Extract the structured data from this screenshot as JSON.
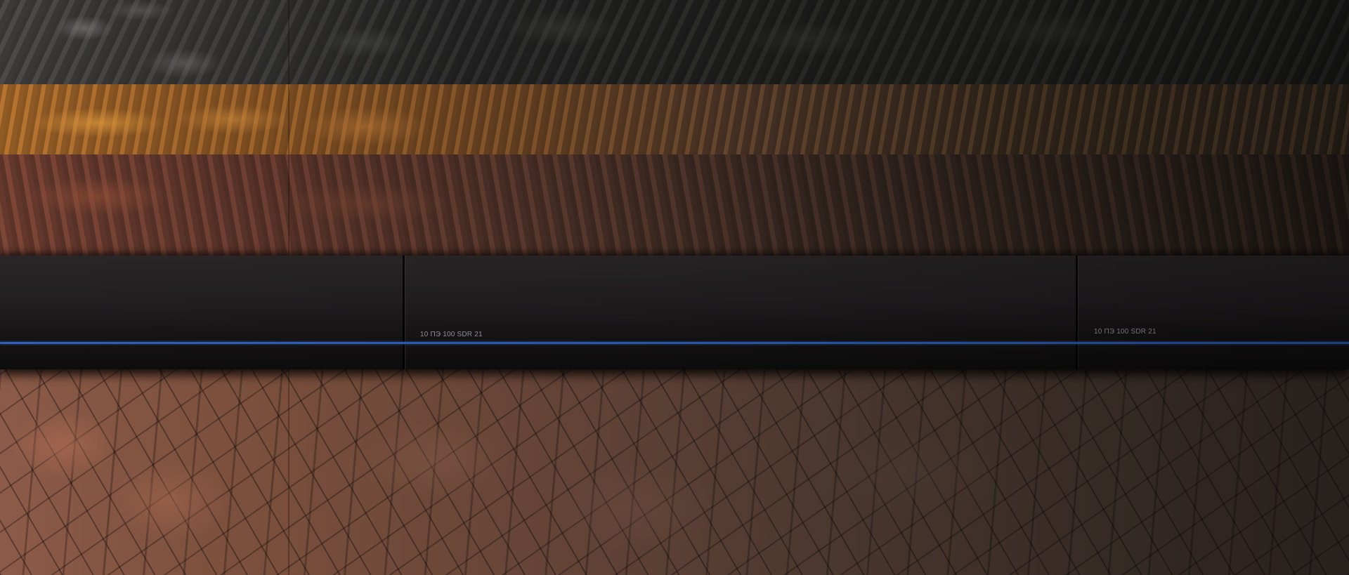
{
  "scene": {
    "pipe_markings": [
      "10 ПЭ 100 SDR 21",
      "10 ПЭ 100 SDR 21"
    ],
    "colors": {
      "pipe": "#1c191b",
      "pipe_stripe": "#2f5fb8",
      "clay": "#b06e2c",
      "soil": "#7a4436",
      "rock": "#3b3a39"
    }
  }
}
